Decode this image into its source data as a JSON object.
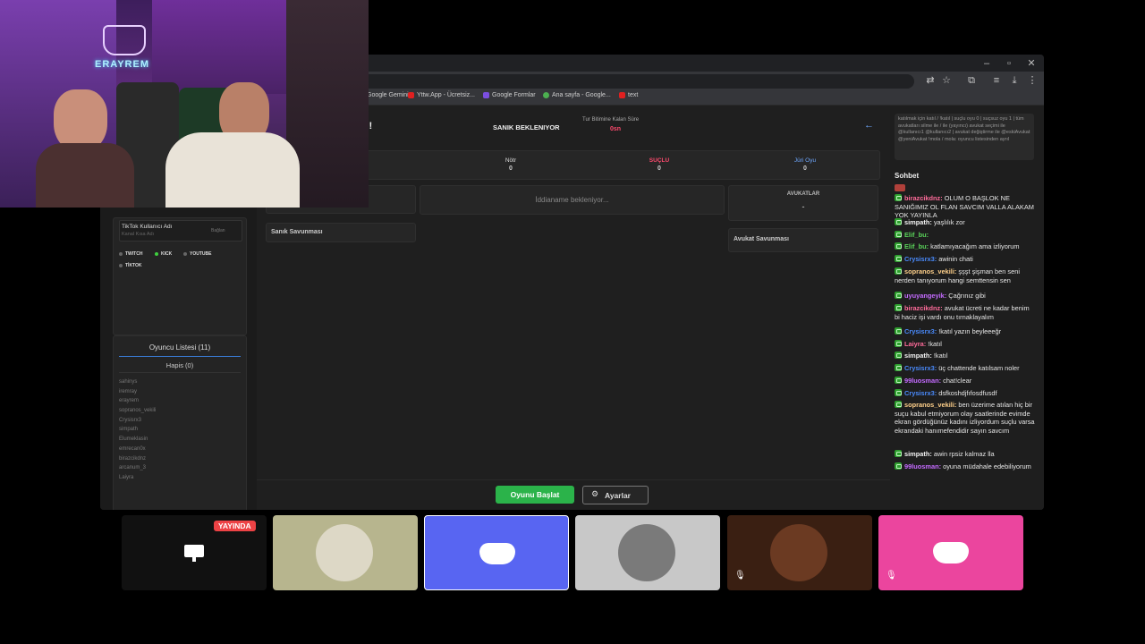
{
  "browser": {
    "window_controls": [
      "–",
      "▫",
      "✕"
    ],
    "bookmarks": [
      {
        "label": "Google Gemini",
        "color": "#8ab4f8"
      },
      {
        "label": "Yttw.App - Ücretsiz...",
        "color": "#e02020"
      },
      {
        "label": "Google Formlar",
        "color": "#7b4ee0"
      },
      {
        "label": "Ana sayfa - Google...",
        "color": "#4caf50"
      },
      {
        "label": "text",
        "color": "#e02020"
      }
    ]
  },
  "game": {
    "title_fragment": "un!",
    "status": "SANIK BEKLENIYOR",
    "timer_label": "Tur Bitimine Kalan Süre",
    "timer_value": "0sn",
    "back_arrow": "←",
    "votes": [
      {
        "label": "Nötr",
        "value": "0",
        "color": "#bbbbbb"
      },
      {
        "label": "SUÇLU",
        "value": "0",
        "color": "#ff4a6e"
      },
      {
        "label": "Jüri Oyu",
        "value": "0",
        "color": "#6fa8ff"
      }
    ],
    "accusation_placeholder": "İddianame bekleniyor...",
    "lawyers_header": "AVUKATLAR",
    "lawyers_value": "-",
    "defendant_defense": "Sanık Savunması",
    "lawyer_defense": "Avukat Savunması",
    "start_button": "Oyunu Başlat",
    "settings_button": "Ayarlar"
  },
  "left": {
    "tiktok_label": "TikTok Kullanıcı Adı",
    "tiktok_hint": "Kanal Kısa Adı",
    "connect_label": "Bağlan",
    "platforms": [
      {
        "label": "TWITCH",
        "active": false
      },
      {
        "label": "KICK",
        "active": true
      },
      {
        "label": "YOUTUBE",
        "active": false
      },
      {
        "label": "TİKTOK",
        "active": false
      }
    ],
    "player_list_tab": "Oyuncu Listesi (11)",
    "jail_tab": "Hapis (0)",
    "players": [
      "sahinys",
      "iremray",
      "erayrem",
      "sopranos_vekili",
      "Crysisrx3",
      "simpath",
      "Elumeklasin",
      "emrecan0x",
      "birazcikdnz",
      "arcanum_3",
      "Laiyra"
    ]
  },
  "chat": {
    "commands_text": "katılmak için katıl / !katıl | suçlu oyu 0 | suçsuz oyu 1 | tüm avukatları silme ile / ile (yayıncı) avukat seçimi ile @kullanıcı1 @kullanıcı2 | avukat değiştirme ile @eskiAvukat @yeniAvukat !mola / mola: oyuncu listesinden ayrıl",
    "header": "Sohbet",
    "messages": [
      {
        "user": "birazcikdnz",
        "text": "OLUM O BAŞLOK NE SANIĞIMIZ OL FLAN SAVCIM VALLA ALAKAM YOK YAYINLA",
        "color": "#ff6b9a"
      },
      {
        "user": "simpath",
        "text": "yaşlılık zor",
        "color": "#f2f2f2"
      },
      {
        "user": "Elif_bu",
        "text": "",
        "color": "#5ad45a"
      },
      {
        "user": "Elif_bu",
        "text": "katlamıyacağım ama izliyorum",
        "color": "#5ad45a"
      },
      {
        "user": "Crysisrx3",
        "text": "awinin chati",
        "color": "#4a8cff"
      },
      {
        "user": "sopranos_vekili",
        "text": "şşşt şişman ben seni nerden tanıyorum hangi semttensin sen",
        "color": "#ffd08a"
      },
      {
        "user": "uyuyangeyik",
        "text": "Çağrınız gibi",
        "color": "#c46bff"
      },
      {
        "user": "birazcikdnz",
        "text": "avukat ücreti ne kadar benim bi haciz işi vardı onu tırnaklayalım",
        "color": "#ff6b9a"
      },
      {
        "user": "Crysisrx3",
        "text": "!katıl yazın beyleeeğr",
        "color": "#4a8cff"
      },
      {
        "user": "Laiyra",
        "text": "!katıl",
        "color": "#ff6b9a"
      },
      {
        "user": "simpath",
        "text": "!katıl",
        "color": "#f2f2f2"
      },
      {
        "user": "Crysisrx3",
        "text": "üç chattende katılsam noler",
        "color": "#4a8cff"
      },
      {
        "user": "99luosman",
        "text": "chat!clear",
        "color": "#c46bff"
      },
      {
        "user": "Crysisrx3",
        "text": "dsfkoshdjfıfosdfusdf",
        "color": "#4a8cff"
      },
      {
        "user": "sopranos_vekili",
        "text": "ben üzerime atılan hiç bir suçu kabul etmiyorum olay saatlerinde evimde ekran gördüğünüz kadını izliyordum suçlu varsa ekrandaki hanımefendidir sayın savcım",
        "color": "#ffd08a"
      },
      {
        "user": "simpath",
        "text": "awin rpsiz kalmaz lla",
        "color": "#f2f2f2"
      },
      {
        "user": "99luosman",
        "text": "oyuna müdahale edebiliyorum",
        "color": "#c46bff"
      }
    ]
  },
  "webcam": {
    "logo_text": "ERAYREM"
  },
  "discord": {
    "live_badge": "YAYINDA",
    "tiles": [
      {
        "kind": "screen",
        "bg": "#111111"
      },
      {
        "kind": "avatar",
        "bg": "#b7b58e"
      },
      {
        "kind": "discord",
        "bg": "#5865f2",
        "selected": true
      },
      {
        "kind": "avatar",
        "bg": "#c8c8c8"
      },
      {
        "kind": "avatar",
        "bg": "#3a1f12",
        "muted": true
      },
      {
        "kind": "discord",
        "bg": "#eb459e",
        "muted": true
      }
    ]
  }
}
